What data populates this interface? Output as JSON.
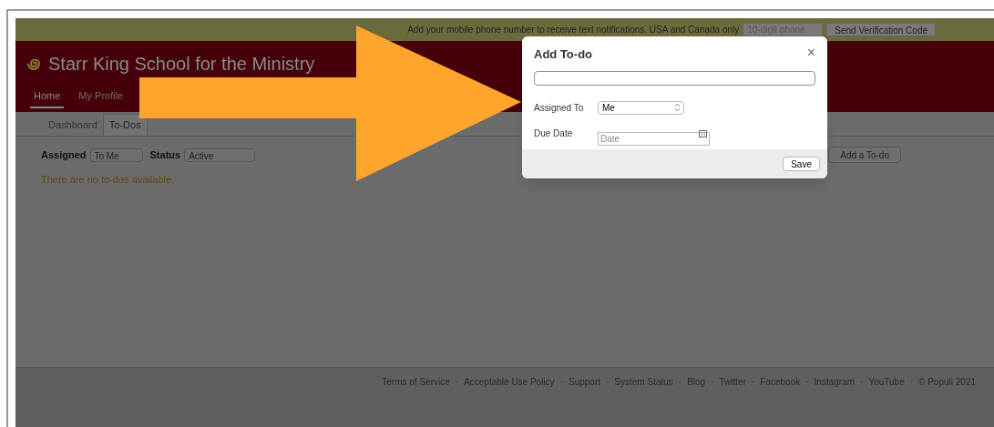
{
  "banner": {
    "text": "Add your mobile phone number to receive text notifications. USA and Canada only",
    "phone_placeholder": "10-digit phone",
    "button": "Send Verification Code"
  },
  "school": {
    "name": "Starr King School for the Ministry"
  },
  "nav": [
    {
      "label": "Home",
      "selected": true
    },
    {
      "label": "My Profile",
      "selected": false
    }
  ],
  "tabs": [
    {
      "label": "Dashboard",
      "selected": false
    },
    {
      "label": "To-Dos",
      "selected": true
    }
  ],
  "filters": [
    {
      "label": "Assigned",
      "value": "To Me"
    },
    {
      "label": "Status",
      "value": "Active"
    }
  ],
  "add_button": "Add a To-do",
  "empty_message": "There are no to-dos available.",
  "footer": {
    "links": [
      "Terms of Service",
      "Acceptable Use Policy",
      "Support",
      "System Status",
      "Blog",
      "Twitter",
      "Facebook",
      "Instagram",
      "YouTube"
    ],
    "copyright": "© Populi 2021",
    "separator": "·"
  },
  "dialog": {
    "title": "Add To-do",
    "close": "×",
    "assigned_label": "Assigned To",
    "assigned_value": "Me",
    "due_label": "Due Date",
    "due_placeholder": "Date",
    "save": "Save"
  }
}
